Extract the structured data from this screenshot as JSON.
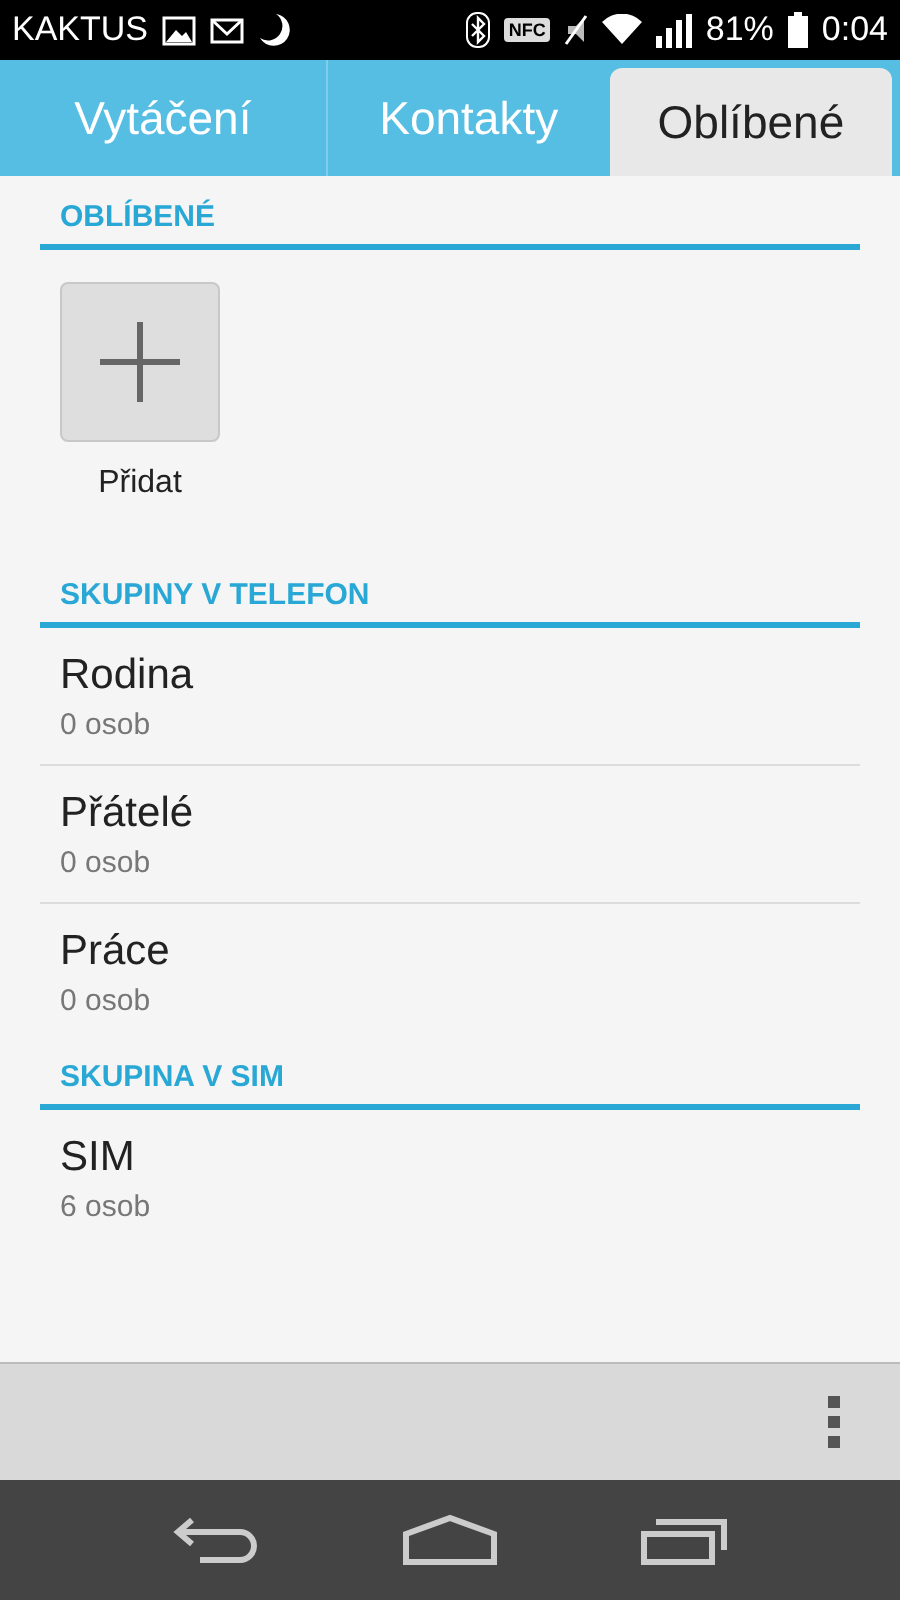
{
  "status_bar": {
    "carrier": "KAKTUS",
    "nfc": "NFC",
    "battery": "81%",
    "time": "0:04"
  },
  "tabs": [
    {
      "label": "Vytáčení",
      "selected": false
    },
    {
      "label": "Kontakty",
      "selected": false
    },
    {
      "label": "Oblíbené",
      "selected": true
    }
  ],
  "favorites": {
    "title": "OBLÍBENÉ",
    "add_label": "Přidat"
  },
  "group_sections": [
    {
      "title": "SKUPINY V TELEFON",
      "items": [
        {
          "name": "Rodina",
          "count": "0 osob"
        },
        {
          "name": "Přátelé",
          "count": "0 osob"
        },
        {
          "name": "Práce",
          "count": "0 osob"
        }
      ]
    },
    {
      "title": "SKUPINA V SIM",
      "items": [
        {
          "name": "SIM",
          "count": "6 osob"
        }
      ]
    }
  ]
}
